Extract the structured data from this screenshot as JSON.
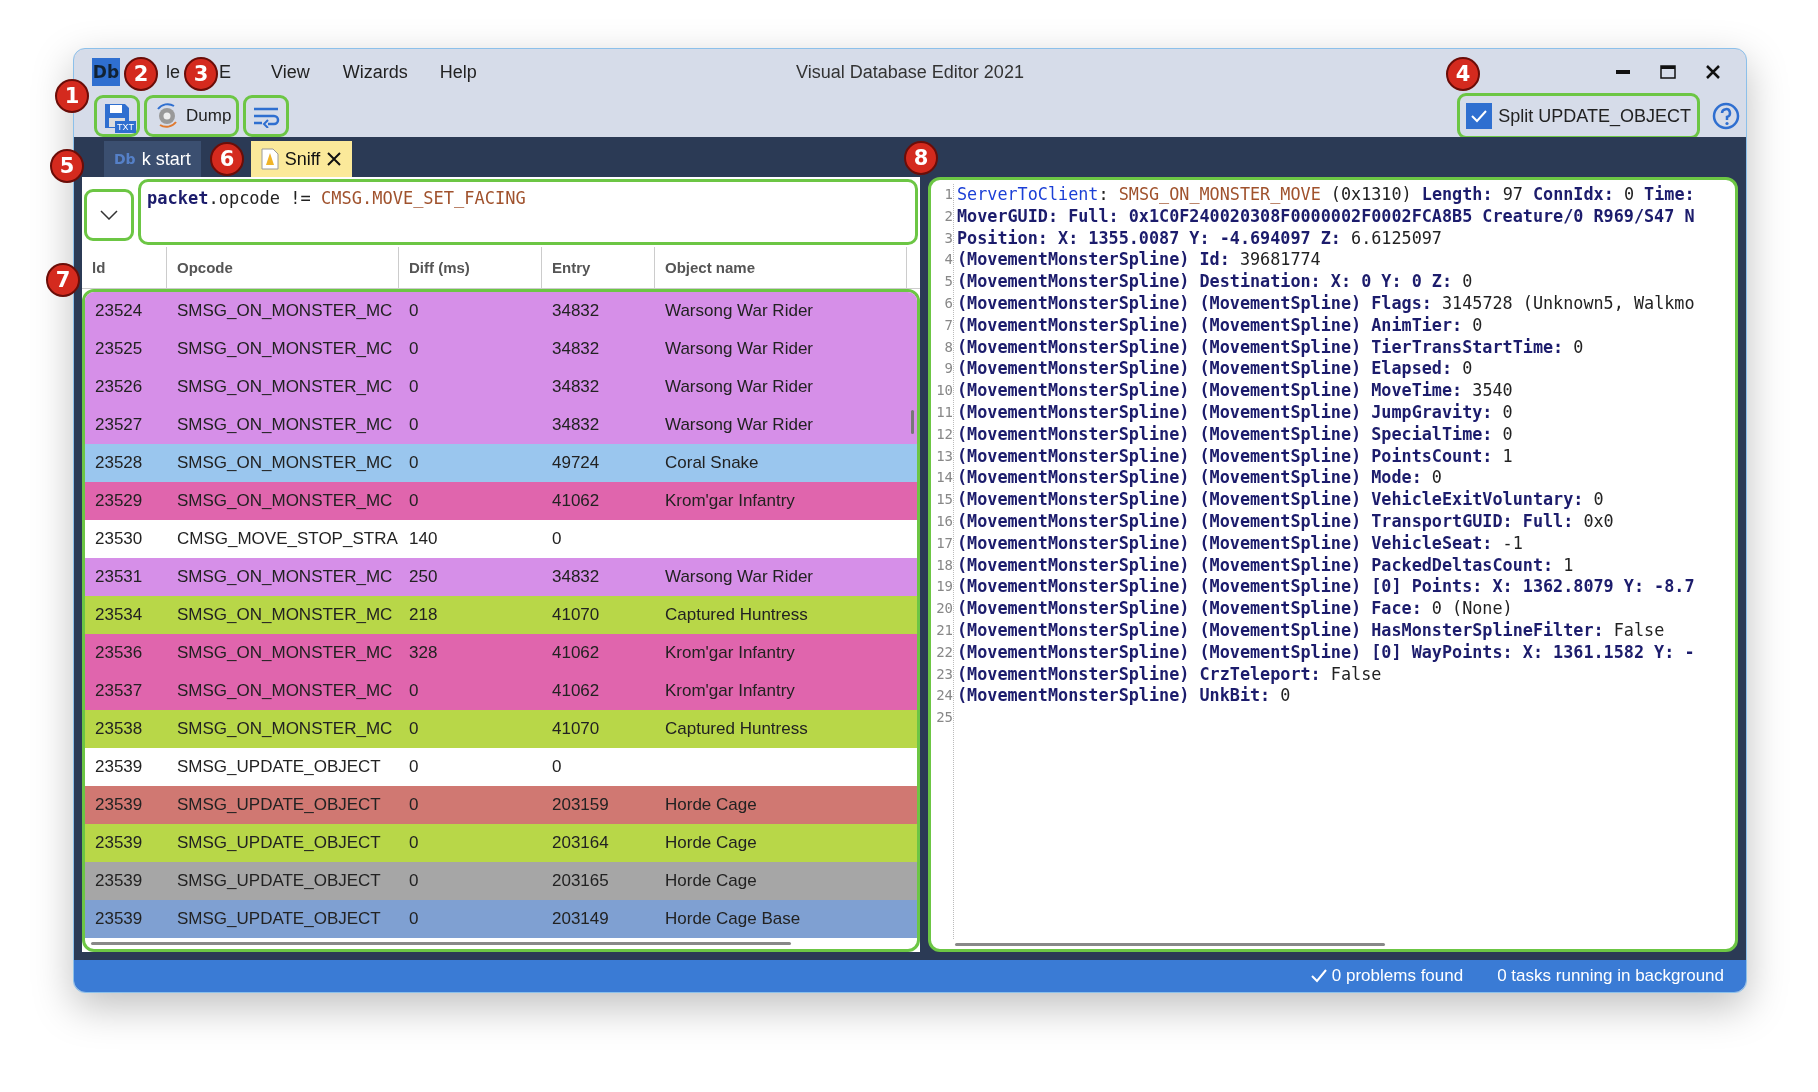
{
  "window": {
    "title": "Visual Database Editor 2021",
    "logo": "Db"
  },
  "menu": [
    {
      "label": "le"
    },
    {
      "label": "E"
    },
    {
      "label": "View"
    },
    {
      "label": "Wizards"
    },
    {
      "label": "Help"
    }
  ],
  "toolbar": {
    "save_tag": "TXT",
    "dump_label": "Dump",
    "split_checkbox": {
      "label": "Split UPDATE_OBJECT",
      "checked": true
    }
  },
  "tabs": [
    {
      "icon": "Db",
      "label": "k start",
      "selected": false,
      "closable": false
    },
    {
      "label": "Sniff",
      "selected": true,
      "closable": true
    }
  ],
  "filter": {
    "value": [
      {
        "kind": "bold",
        "text": "packet"
      },
      {
        "kind": "plain",
        "text": ".opcode != "
      },
      {
        "kind": "brown",
        "text": "CMSG.MOVE_SET_FACING"
      }
    ]
  },
  "table": {
    "columns": [
      "ld",
      "Opcode",
      "Diff (ms)",
      "Entry",
      "Object name"
    ],
    "rows": [
      {
        "cells": [
          "23524",
          "SMSG_ON_MONSTER_MC",
          "0",
          "34832",
          "Warsong War Rider"
        ],
        "color": "#d68fe8"
      },
      {
        "cells": [
          "23525",
          "SMSG_ON_MONSTER_MC",
          "0",
          "34832",
          "Warsong War Rider"
        ],
        "color": "#d68fe8"
      },
      {
        "cells": [
          "23526",
          "SMSG_ON_MONSTER_MC",
          "0",
          "34832",
          "Warsong War Rider"
        ],
        "color": "#d68fe8"
      },
      {
        "cells": [
          "23527",
          "SMSG_ON_MONSTER_MC",
          "0",
          "34832",
          "Warsong War Rider"
        ],
        "color": "#d68fe8"
      },
      {
        "cells": [
          "23528",
          "SMSG_ON_MONSTER_MC",
          "0",
          "49724",
          "Coral Snake"
        ],
        "color": "#9ac6ee"
      },
      {
        "cells": [
          "23529",
          "SMSG_ON_MONSTER_MC",
          "0",
          "41062",
          "Krom'gar Infantry"
        ],
        "color": "#e065ad"
      },
      {
        "cells": [
          "23530",
          "CMSG_MOVE_STOP_STRA",
          "140",
          "0",
          ""
        ],
        "color": "#ffffff"
      },
      {
        "cells": [
          "23531",
          "SMSG_ON_MONSTER_MC",
          "250",
          "34832",
          "Warsong War Rider"
        ],
        "color": "#d68fe8"
      },
      {
        "cells": [
          "23534",
          "SMSG_ON_MONSTER_MC",
          "218",
          "41070",
          "Captured Huntress"
        ],
        "color": "#b8d748"
      },
      {
        "cells": [
          "23536",
          "SMSG_ON_MONSTER_MC",
          "328",
          "41062",
          "Krom'gar Infantry"
        ],
        "color": "#e065ad"
      },
      {
        "cells": [
          "23537",
          "SMSG_ON_MONSTER_MC",
          "0",
          "41062",
          "Krom'gar Infantry"
        ],
        "color": "#e065ad"
      },
      {
        "cells": [
          "23538",
          "SMSG_ON_MONSTER_MC",
          "0",
          "41070",
          "Captured Huntress"
        ],
        "color": "#b8d748"
      },
      {
        "cells": [
          "23539",
          "SMSG_UPDATE_OBJECT",
          "0",
          "0",
          ""
        ],
        "color": "#ffffff"
      },
      {
        "cells": [
          "23539",
          "SMSG_UPDATE_OBJECT",
          "0",
          "203159",
          "Horde Cage"
        ],
        "color": "#d07872"
      },
      {
        "cells": [
          "23539",
          "SMSG_UPDATE_OBJECT",
          "0",
          "203164",
          "Horde Cage"
        ],
        "color": "#b8d748"
      },
      {
        "cells": [
          "23539",
          "SMSG_UPDATE_OBJECT",
          "0",
          "203165",
          "Horde Cage"
        ],
        "color": "#a6a6a6"
      },
      {
        "cells": [
          "23539",
          "SMSG_UPDATE_OBJECT",
          "0",
          "203149",
          "Horde Cage Base"
        ],
        "color": "#7fa0d2"
      }
    ]
  },
  "packet_view": {
    "lines": [
      {
        "number": "1",
        "segments": [
          {
            "kind": "blue",
            "text": "ServerToClient"
          },
          {
            "kind": "plain",
            "text": ": "
          },
          {
            "kind": "brown",
            "text": "SMSG_ON_MONSTER_MOVE"
          },
          {
            "kind": "plain",
            "text": " (0x1310) "
          },
          {
            "kind": "bold",
            "text": "Length:"
          },
          {
            "kind": "plain",
            "text": " 97 "
          },
          {
            "kind": "bold",
            "text": "ConnIdx:"
          },
          {
            "kind": "plain",
            "text": " 0 "
          },
          {
            "kind": "bold",
            "text": "Time:"
          }
        ]
      },
      {
        "number": "2",
        "segments": [
          {
            "kind": "bold",
            "text": "MoverGUID: Full: 0x1C0F240020308F0000002F0002FCA8B5 Creature/0 R969/S47 N"
          }
        ]
      },
      {
        "number": "3",
        "segments": [
          {
            "kind": "bold",
            "text": "Position: X: 1355.0087 Y: -4.694097 Z:"
          },
          {
            "kind": "plain",
            "text": " 6.6125097"
          }
        ]
      },
      {
        "number": "4",
        "segments": [
          {
            "kind": "bold",
            "text": "(MovementMonsterSpline) Id:"
          },
          {
            "kind": "plain",
            "text": " 39681774"
          }
        ]
      },
      {
        "number": "5",
        "segments": [
          {
            "kind": "bold",
            "text": "(MovementMonsterSpline) Destination: X: 0 Y: 0 Z:"
          },
          {
            "kind": "plain",
            "text": " 0"
          }
        ]
      },
      {
        "number": "6",
        "segments": [
          {
            "kind": "bold",
            "text": "(MovementMonsterSpline) (MovementSpline) Flags:"
          },
          {
            "kind": "plain",
            "text": " 3145728 (Unknown5, Walkmo"
          }
        ]
      },
      {
        "number": "7",
        "segments": [
          {
            "kind": "bold",
            "text": "(MovementMonsterSpline) (MovementSpline) AnimTier:"
          },
          {
            "kind": "plain",
            "text": " 0"
          }
        ]
      },
      {
        "number": "8",
        "segments": [
          {
            "kind": "bold",
            "text": "(MovementMonsterSpline) (MovementSpline) TierTransStartTime:"
          },
          {
            "kind": "plain",
            "text": " 0"
          }
        ]
      },
      {
        "number": "9",
        "segments": [
          {
            "kind": "bold",
            "text": "(MovementMonsterSpline) (MovementSpline) Elapsed:"
          },
          {
            "kind": "plain",
            "text": " 0"
          }
        ]
      },
      {
        "number": "10",
        "segments": [
          {
            "kind": "bold",
            "text": "(MovementMonsterSpline) (MovementSpline) MoveTime:"
          },
          {
            "kind": "plain",
            "text": " 3540"
          }
        ]
      },
      {
        "number": "11",
        "segments": [
          {
            "kind": "bold",
            "text": "(MovementMonsterSpline) (MovementSpline) JumpGravity:"
          },
          {
            "kind": "plain",
            "text": " 0"
          }
        ]
      },
      {
        "number": "12",
        "segments": [
          {
            "kind": "bold",
            "text": "(MovementMonsterSpline) (MovementSpline) SpecialTime:"
          },
          {
            "kind": "plain",
            "text": " 0"
          }
        ]
      },
      {
        "number": "13",
        "segments": [
          {
            "kind": "bold",
            "text": "(MovementMonsterSpline) (MovementSpline) PointsCount:"
          },
          {
            "kind": "plain",
            "text": " 1"
          }
        ]
      },
      {
        "number": "14",
        "segments": [
          {
            "kind": "bold",
            "text": "(MovementMonsterSpline) (MovementSpline) Mode:"
          },
          {
            "kind": "plain",
            "text": " 0"
          }
        ]
      },
      {
        "number": "15",
        "segments": [
          {
            "kind": "bold",
            "text": "(MovementMonsterSpline) (MovementSpline) VehicleExitVoluntary:"
          },
          {
            "kind": "plain",
            "text": " 0"
          }
        ]
      },
      {
        "number": "16",
        "segments": [
          {
            "kind": "bold",
            "text": "(MovementMonsterSpline) (MovementSpline) TransportGUID: Full:"
          },
          {
            "kind": "plain",
            "text": " 0x0"
          }
        ]
      },
      {
        "number": "17",
        "segments": [
          {
            "kind": "bold",
            "text": "(MovementMonsterSpline) (MovementSpline) VehicleSeat:"
          },
          {
            "kind": "plain",
            "text": " -1"
          }
        ]
      },
      {
        "number": "18",
        "segments": [
          {
            "kind": "bold",
            "text": "(MovementMonsterSpline) (MovementSpline) PackedDeltasCount:"
          },
          {
            "kind": "plain",
            "text": " 1"
          }
        ]
      },
      {
        "number": "19",
        "segments": [
          {
            "kind": "bold",
            "text": "(MovementMonsterSpline) (MovementSpline) [0] Points: X: 1362.8079 Y: -8.7"
          }
        ]
      },
      {
        "number": "20",
        "segments": [
          {
            "kind": "bold",
            "text": "(MovementMonsterSpline) (MovementSpline) Face:"
          },
          {
            "kind": "plain",
            "text": " 0 (None)"
          }
        ]
      },
      {
        "number": "21",
        "segments": [
          {
            "kind": "bold",
            "text": "(MovementMonsterSpline) (MovementSpline) HasMonsterSplineFilter:"
          },
          {
            "kind": "plain",
            "text": " False"
          }
        ]
      },
      {
        "number": "22",
        "segments": [
          {
            "kind": "bold",
            "text": "(MovementMonsterSpline) (MovementSpline) [0] WayPoints: X: 1361.1582 Y: -"
          }
        ]
      },
      {
        "number": "23",
        "segments": [
          {
            "kind": "bold",
            "text": "(MovementMonsterSpline) CrzTeleport:"
          },
          {
            "kind": "plain",
            "text": " False"
          }
        ]
      },
      {
        "number": "24",
        "segments": [
          {
            "kind": "bold",
            "text": "(MovementMonsterSpline) UnkBit:"
          },
          {
            "kind": "plain",
            "text": " 0"
          }
        ]
      },
      {
        "number": "25"
      }
    ]
  },
  "status_bar": {
    "problems": "0 problems found",
    "tasks": "0 tasks running in background"
  },
  "callouts": [
    "1",
    "2",
    "3",
    "4",
    "5",
    "6",
    "7",
    "8"
  ]
}
